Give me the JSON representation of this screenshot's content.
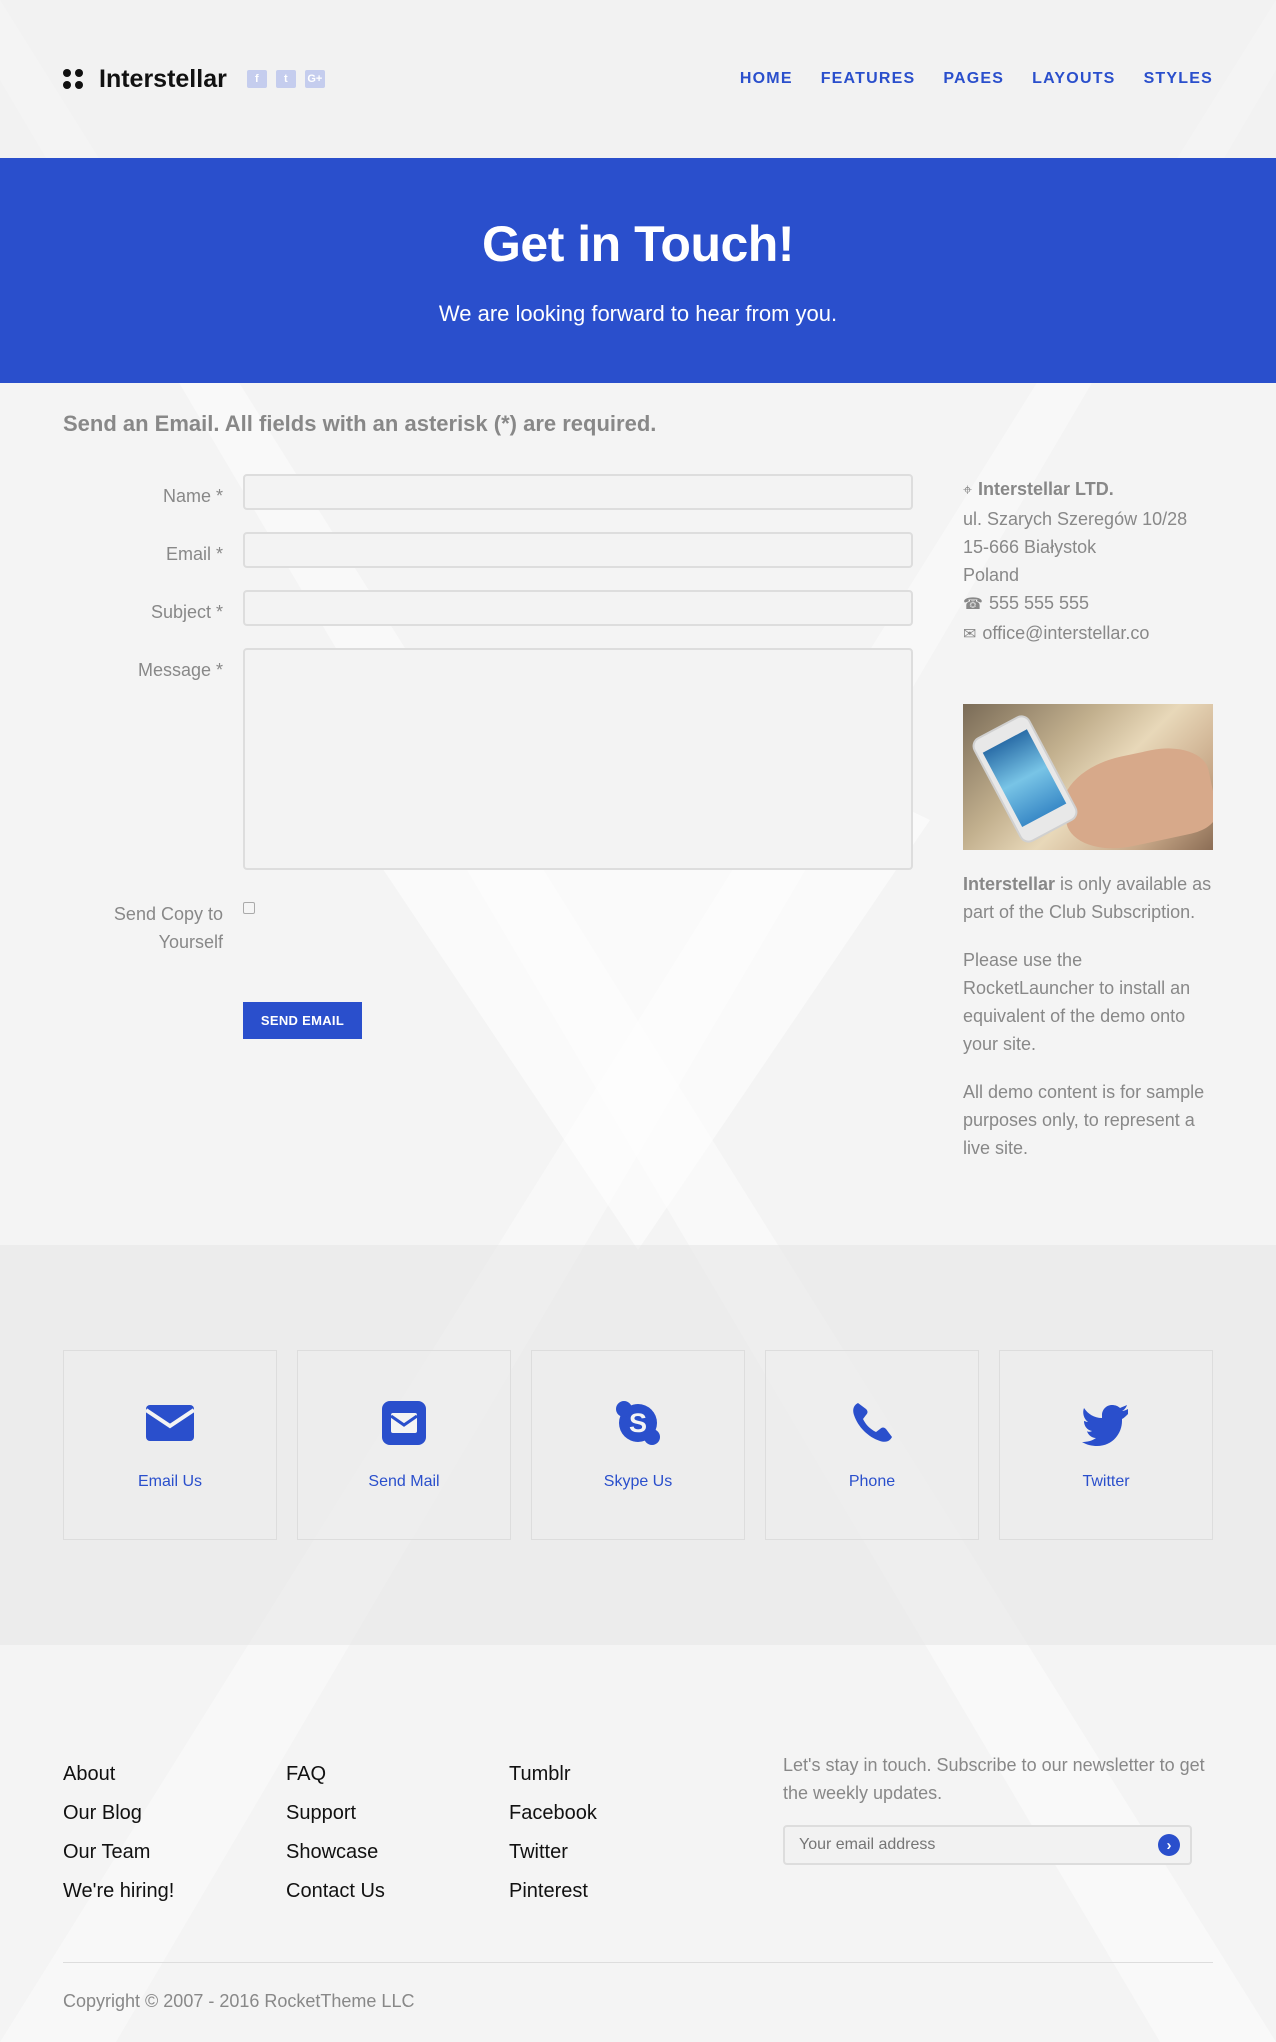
{
  "header": {
    "brand_name": "Interstellar",
    "socials": [
      "f",
      "t",
      "G+"
    ],
    "nav": [
      "HOME",
      "FEATURES",
      "PAGES",
      "LAYOUTS",
      "STYLES"
    ]
  },
  "hero": {
    "title": "Get in Touch!",
    "subtitle": "We are looking forward to hear from you."
  },
  "form": {
    "title": "Send an Email. All fields with an asterisk (*) are required.",
    "name_label": "Name *",
    "email_label": "Email *",
    "subject_label": "Subject *",
    "message_label": "Message *",
    "copy_label": "Send Copy to Yourself",
    "send_label": "SEND EMAIL"
  },
  "sidebar": {
    "company": "Interstellar LTD.",
    "address1": "ul. Szarych Szeregów 10/28",
    "address2": "15-666 Białystok",
    "country": "Poland",
    "phone": "555 555 555",
    "email": "office@interstellar.co",
    "p1_bold": "Interstellar",
    "p1_rest": " is only available as part of the Club Subscription.",
    "p2": "Please use the RocketLauncher to install an equivalent of the demo onto your site.",
    "p3": "All demo content is for sample purposes only, to represent a live site."
  },
  "cards": [
    {
      "label": "Email Us",
      "icon": "envelope-icon"
    },
    {
      "label": "Send Mail",
      "icon": "envelope-square-icon"
    },
    {
      "label": "Skype Us",
      "icon": "skype-icon"
    },
    {
      "label": "Phone",
      "icon": "phone-icon"
    },
    {
      "label": "Twitter",
      "icon": "twitter-icon"
    }
  ],
  "footer": {
    "col1": [
      "About",
      "Our Blog",
      "Our Team",
      "We're hiring!"
    ],
    "col2": [
      "FAQ",
      "Support",
      "Showcase",
      "Contact Us"
    ],
    "col3": [
      "Tumblr",
      "Facebook",
      "Twitter",
      "Pinterest"
    ],
    "newsletter_text": "Let's stay in touch. Subscribe to our newsletter to get the weekly updates.",
    "email_placeholder": "Your email address",
    "copyright": "Copyright © 2007 - 2016 RocketTheme LLC"
  },
  "colors": {
    "accent": "#2a4fcc",
    "background": "#f4f4f4",
    "text_muted": "#888888"
  }
}
